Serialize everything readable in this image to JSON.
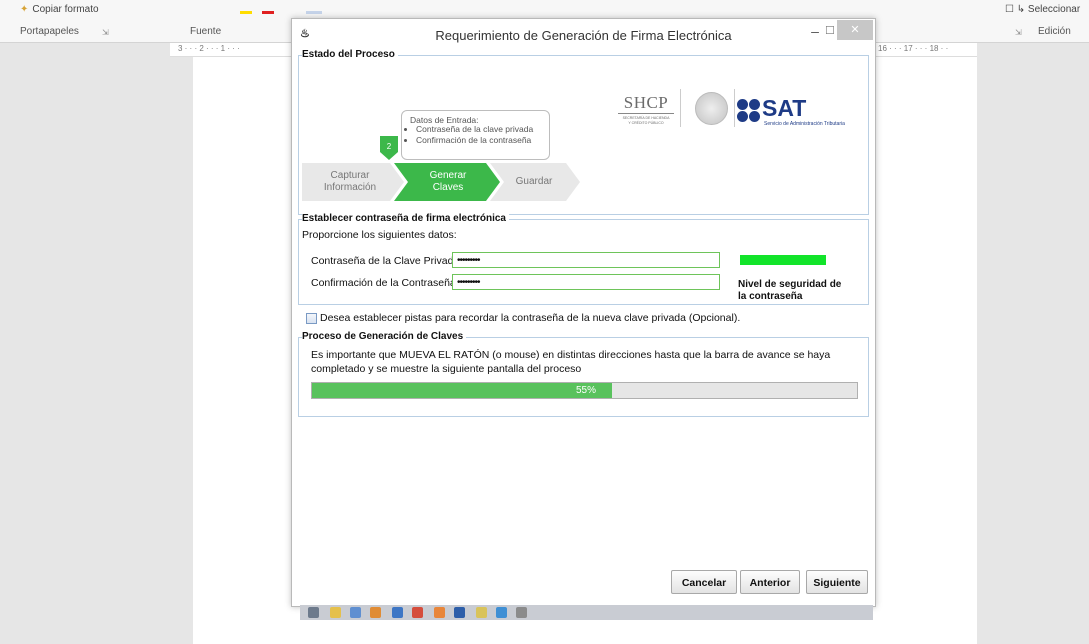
{
  "word": {
    "copy_format": "Copiar formato",
    "select": "Seleccionar",
    "groups": {
      "clipboard": "Portapapeles",
      "font": "Fuente",
      "editing": "Edición"
    },
    "ruler_left": "3 · · · 2 · · · 1 · · ·",
    "ruler_right": "16 · · · 17 · · · 18 · ·"
  },
  "dialog": {
    "title": "Requerimiento de Generación de Firma Electrónica",
    "process_status": {
      "legend": "Estado del Proceso",
      "logos": {
        "shcp": "SHCP",
        "shcp_sub_1": "SECRETARÍA DE HACIENDA",
        "shcp_sub_2": "Y CRÉDITO PÚBLICO",
        "sat": "SAT",
        "sat_sub": "Servicio de Administración Tributaria"
      },
      "current_step_number": "2",
      "callout": {
        "heading": "Datos de Entrada:",
        "items": [
          "Contraseña de la clave privada",
          "Confirmación de la contraseña"
        ]
      },
      "steps": [
        {
          "line1": "Capturar",
          "line2": "Información",
          "state": "done"
        },
        {
          "line1": "Generar",
          "line2": "Claves",
          "state": "active"
        },
        {
          "line1": "Guardar",
          "line2": "",
          "state": "pending"
        }
      ]
    },
    "password": {
      "legend": "Establecer contraseña de firma electrónica",
      "intro": "Proporcione los siguientes datos:",
      "private_key_label": "Contraseña de la Clave Privada",
      "private_key_value": "•••••••••",
      "confirm_label": "Confirmación de la Contraseña",
      "confirm_value": "•••••••••",
      "strength_label_1": "Nivel de seguridad de",
      "strength_label_2": "la contraseña",
      "strength_color": "#12e42a"
    },
    "hints_checkbox": {
      "label": "Desea establecer pistas para recordar la contraseña de la nueva clave privada (Opcional).",
      "checked": false
    },
    "key_generation": {
      "legend": "Proceso de Generación de Claves",
      "message_1": "Es importante que MUEVA EL RATÓN (o mouse) en distintas direcciones hasta que la barra de avance se haya",
      "message_2": "completado y se muestre la siguiente pantalla del proceso",
      "progress": 0.55,
      "progress_label": "55%",
      "progress_color": "#59c25d"
    },
    "buttons": {
      "cancel": "Cancelar",
      "previous": "Anterior",
      "next": "Siguiente"
    }
  }
}
